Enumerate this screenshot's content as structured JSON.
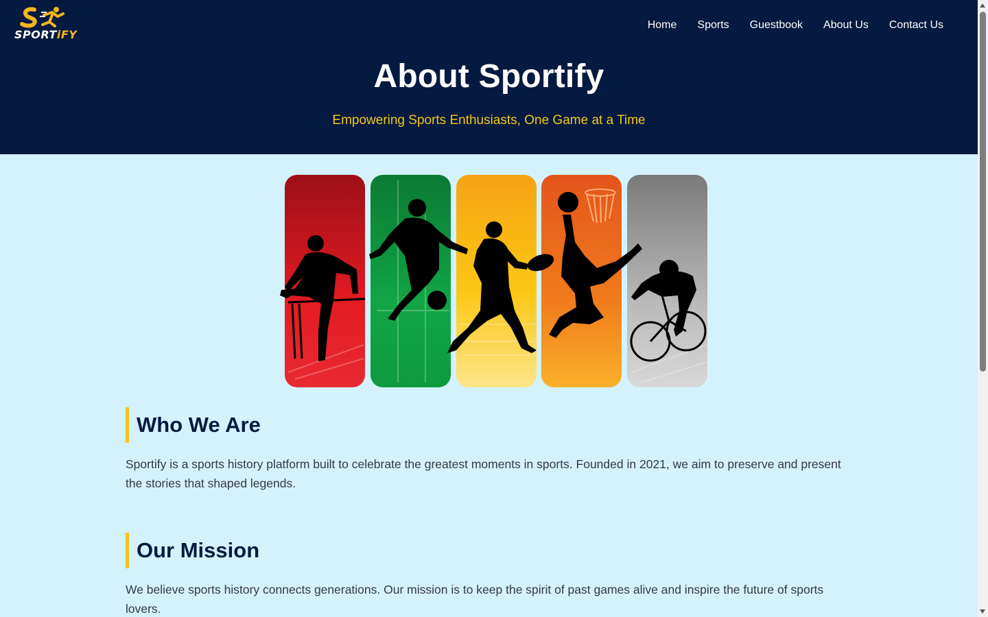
{
  "brand": {
    "name_main": "SPORT",
    "name_accent": "iFY",
    "logo_icon": "runner-logo-icon",
    "colors": {
      "accent": "#f5b51e",
      "header_bg": "#041a40",
      "page_bg": "#d4f2fc"
    }
  },
  "nav": {
    "items": [
      {
        "label": "Home"
      },
      {
        "label": "Sports"
      },
      {
        "label": "Guestbook"
      },
      {
        "label": "About Us"
      },
      {
        "label": "Contact Us"
      }
    ]
  },
  "hero": {
    "title": "About Sportify",
    "subtitle": "Empowering Sports Enthusiasts, One Game at a Time"
  },
  "banner": {
    "panels": [
      {
        "sport": "hurdles",
        "color": "#e31b23"
      },
      {
        "sport": "soccer",
        "color": "#0f9a3e"
      },
      {
        "sport": "rugby",
        "color": "#fcbf16"
      },
      {
        "sport": "basketball",
        "color": "#f07c1c"
      },
      {
        "sport": "cycling",
        "color": "#a9a9a9"
      }
    ]
  },
  "sections": [
    {
      "heading": "Who We Are",
      "body": "Sportify is a sports history platform built to celebrate the greatest moments in sports. Founded in 2021, we aim to preserve and present the stories that shaped legends."
    },
    {
      "heading": "Our Mission",
      "body": "We believe sports history connects generations. Our mission is to keep the spirit of past games alive and inspire the future of sports lovers."
    }
  ]
}
